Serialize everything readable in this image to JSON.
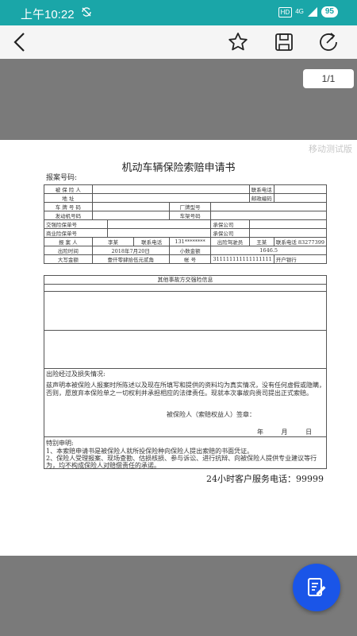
{
  "status": {
    "time": "上午10:22",
    "hd": "HD",
    "network": "4G",
    "battery": "95"
  },
  "icons": {
    "back": "back-arrow-icon",
    "star": "star-icon",
    "save": "save-disk-icon",
    "share": "share-icon",
    "fab": "edit-note-icon"
  },
  "viewer": {
    "page_indicator": "1/1"
  },
  "document": {
    "watermark": "移动测试版",
    "title": "机动车辆保险索赔申请书",
    "report_no": "报案号码:",
    "rows": {
      "insured_label": "被 保 险 人",
      "contact_phone_label": "联系电话",
      "address_label": "地      址",
      "postcode_label": "邮政编码",
      "plate_label": "车 牌 号 码",
      "brand_label": "厂牌型号",
      "engine_label": "发动机号码",
      "vin_label": "车架号码",
      "compulsory_label": "交强险保单号",
      "insurer1_label": "承保公司",
      "commercial_label": "商业险保单号",
      "insurer2_label": "承保公司",
      "reporter_label": "报 案 人",
      "reporter_value": "李某",
      "reporter_phone_label": "联系电话",
      "reporter_phone_value": "131********",
      "driver_label": "出险驾驶员",
      "driver_value": "王某",
      "driver_phone_label": "联系电话",
      "driver_phone_value": "83277399",
      "time_label": "出险时间",
      "time_value": "2018年7月20日",
      "amount_label": "小数金额",
      "amount_value": "1646.5",
      "cap_label": "大写金额",
      "cap_value": "壹仟零肆拾伍元贰角",
      "account_label": "帐    号",
      "account_value": "311111111111111111",
      "bank_label": "开户银行"
    },
    "sec_other_parties": "其他事故方交强险信息",
    "accident_label": "出险经过及损失情况:",
    "declaration": "兹声明本被保险人报案时所陈述以及现在所填写和提供的资料均为真实情况，没有任何虚假或隐瞒，否则，愿放弃本保险单之一切权利并承担相应的法律责任。现就本次事故向贵司提出正式索赔。",
    "sign_label": "被保险人（索赔权益人）签章：",
    "date_label": "年 月 日",
    "special_label": "特别申明:",
    "note1": "1、本索赔申请书是被保险人就所投保险种向保险人提出索赔的书面凭证。",
    "note2": "2、保险人受理报案、现场查勘、估损核损、参与诉讼、进行抗辩、向被保险人提供专业建议等行为，均不构成保险人对赔偿责任的承诺。",
    "hotline": "24小时客户服务电话：99999"
  }
}
